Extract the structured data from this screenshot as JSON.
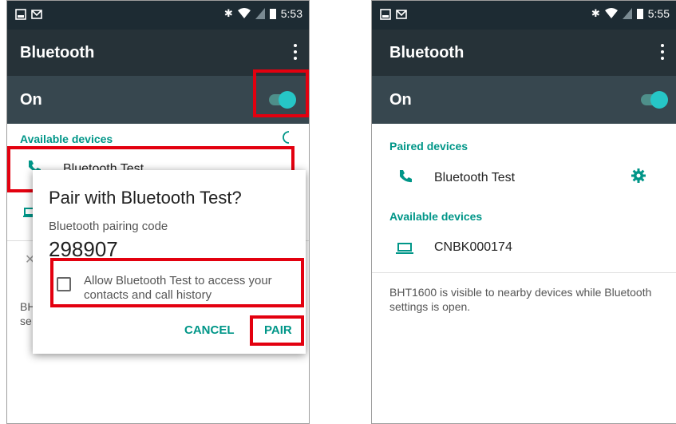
{
  "left": {
    "status_time": "5:53",
    "app_title": "Bluetooth",
    "on_label": "On",
    "available_header": "Available devices",
    "device_name": "Bluetooth Test",
    "partial_footer": "BH\nse",
    "dialog": {
      "title": "Pair with Bluetooth Test?",
      "subtitle": "Bluetooth pairing code",
      "code": "298907",
      "checkbox_text": "Allow Bluetooth Test to access your contacts and call history",
      "cancel_label": "CANCEL",
      "pair_label": "PAIR"
    }
  },
  "right": {
    "status_time": "5:55",
    "app_title": "Bluetooth",
    "on_label": "On",
    "paired_header": "Paired devices",
    "paired_device": "Bluetooth Test",
    "available_header": "Available devices",
    "available_device": "CNBK000174",
    "visibility_note": "BHT1600 is visible to nearby devices while Bluetooth settings is open."
  },
  "colors": {
    "accent": "#009688",
    "highlight": "#e3000f",
    "appbar": "#263238",
    "onbar": "#37474f",
    "statusbar": "#1d2b33"
  },
  "icons": {
    "status_left": [
      "image-icon",
      "mail-icon"
    ],
    "status_right": [
      "bluetooth-icon",
      "wifi-icon",
      "no-sim-icon",
      "battery-icon"
    ],
    "device_icons": [
      "phone-icon",
      "laptop-icon",
      "gear-icon",
      "refresh-icon"
    ]
  }
}
